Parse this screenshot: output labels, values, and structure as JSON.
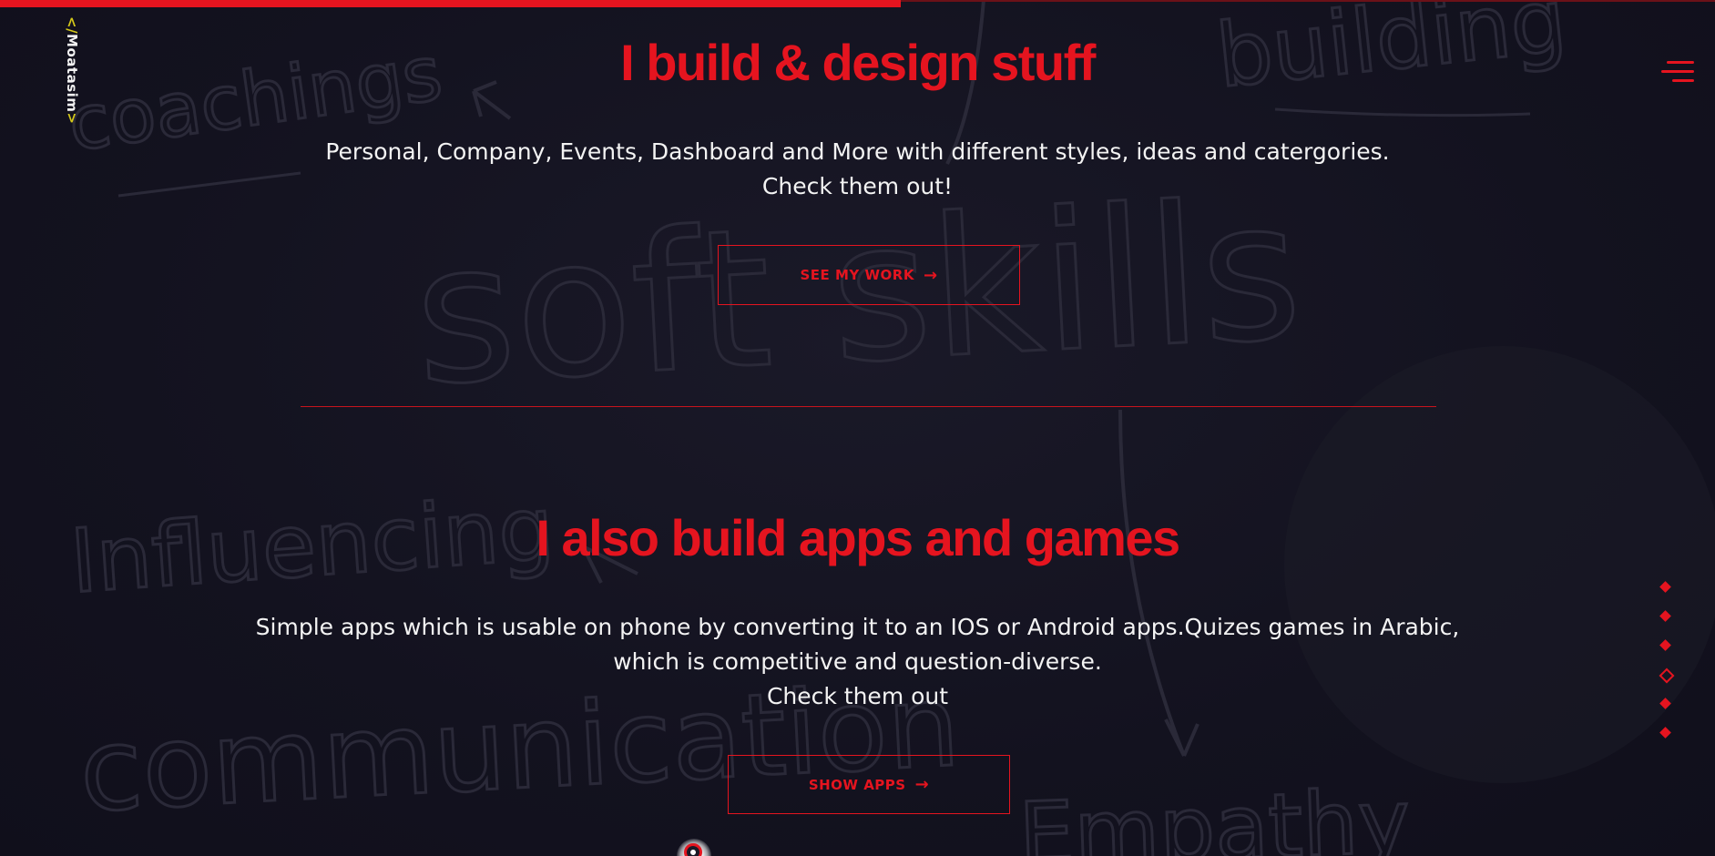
{
  "brand": {
    "logo_open": "</",
    "logo_name": "Moatasim",
    "logo_close": ">"
  },
  "progress": {
    "fraction": 0.525
  },
  "section_design": {
    "title": "I build & design stuff",
    "desc_line1": "Personal, Company, Events, Dashboard and More with different styles, ideas and catergories.",
    "desc_line2": "Check them out!",
    "button_label": "SEE MY WORK",
    "button_icon": "arrow-right-icon"
  },
  "section_apps": {
    "title": "I also build apps and games",
    "desc_line1": "Simple apps which is usable on phone by converting it to an IOS or Android apps.Quizes games in Arabic,",
    "desc_line2": "which is competitive and question-diverse.",
    "desc_line3": "Check them out",
    "button_label": "SHOW APPS",
    "button_icon": "arrow-right-icon"
  },
  "section_nav": {
    "count": 6,
    "active_index": 3
  },
  "background_words": {
    "w1": "coachings",
    "w2": "building",
    "w3": "soft skills",
    "w4": "Influencing",
    "w5": "communication",
    "w6": "Empathy"
  },
  "colors": {
    "accent": "#e5141f",
    "background": "#13121f",
    "logo_bracket": "#d4c81a",
    "text": "#f3f3f3"
  }
}
